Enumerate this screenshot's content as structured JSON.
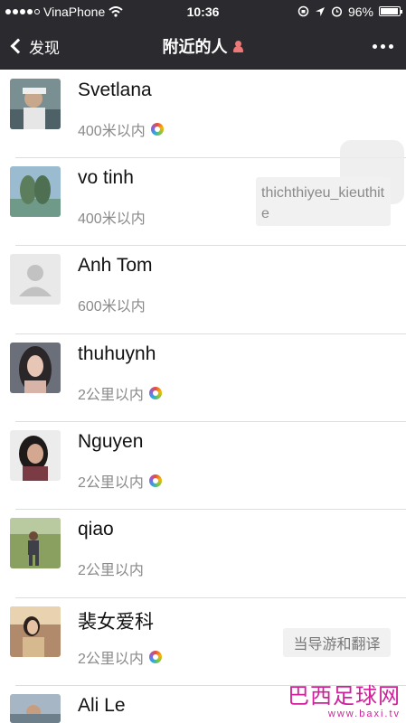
{
  "status_bar": {
    "carrier": "VinaPhone",
    "time": "10:36",
    "battery_percent": "96%",
    "battery_level": 0.96,
    "signal_bars": 4
  },
  "nav": {
    "back_label": "发现",
    "title": "附近的人"
  },
  "people": [
    {
      "name": "Svetlana",
      "distance": "400米以内",
      "moments": true
    },
    {
      "name": "vo tinh",
      "distance": "400米以内",
      "moments": false
    },
    {
      "name": "Anh Tom",
      "distance": "600米以内",
      "moments": false
    },
    {
      "name": "thuhuynh",
      "distance": "2公里以内",
      "moments": true
    },
    {
      "name": "Nguyen",
      "distance": "2公里以内",
      "moments": true
    },
    {
      "name": "qiao",
      "distance": "2公里以内",
      "moments": false
    },
    {
      "name": "裴女爱科",
      "distance": "2公里以内",
      "moments": true
    },
    {
      "name": "Ali Le",
      "distance": "",
      "moments": false
    }
  ],
  "overlay": {
    "username": "thichthiyeu_kieuthite",
    "translate_badge": "当导游和翻译"
  },
  "watermark": {
    "text": "巴西足球网",
    "url": "www.baxi.tv"
  }
}
